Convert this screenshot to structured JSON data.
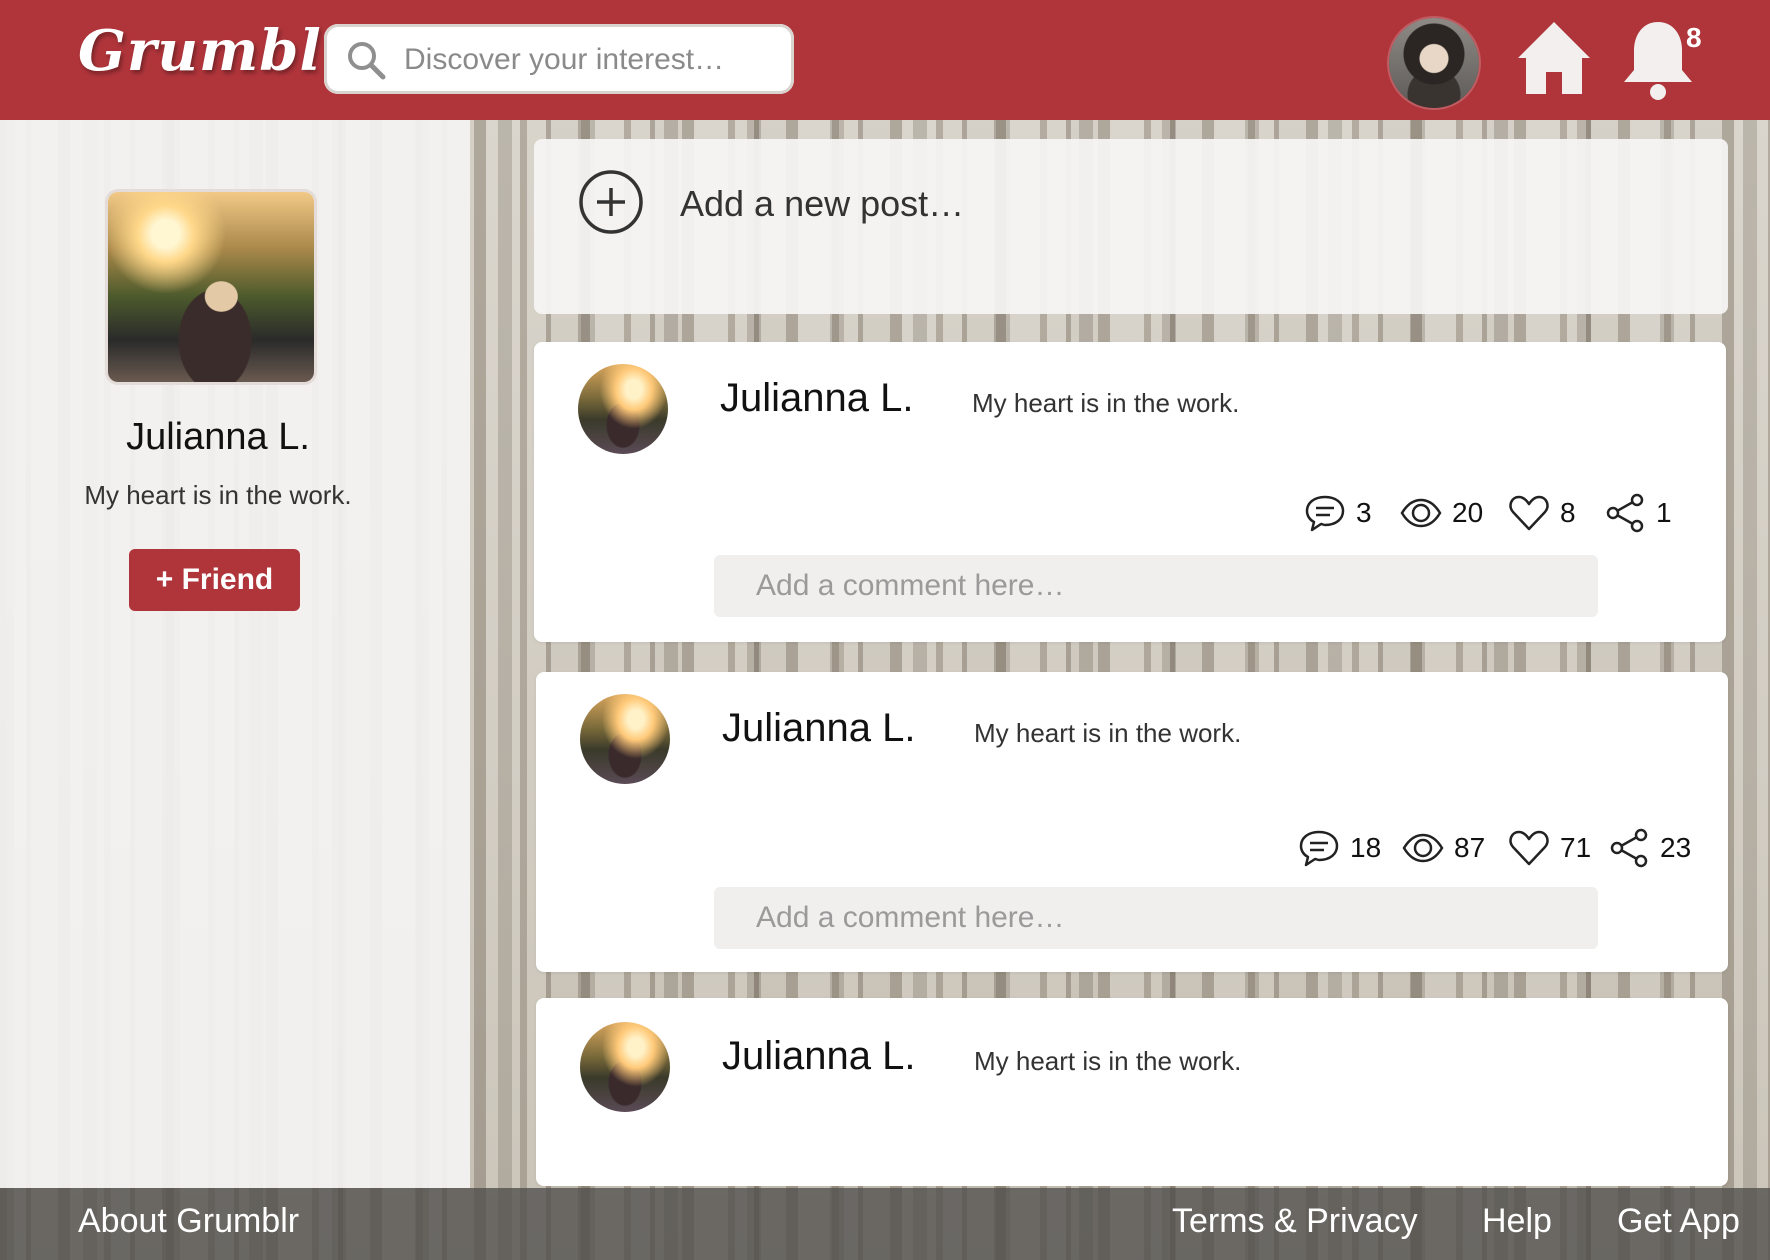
{
  "app": {
    "logo": "Grumblr"
  },
  "header": {
    "search_placeholder": "Discover your interest…",
    "notification_count": "8"
  },
  "profile": {
    "name": "Julianna L.",
    "tagline": "My heart is in the work.",
    "friend_button": "+ Friend"
  },
  "new_post": {
    "label": "Add a new post…"
  },
  "posts": [
    {
      "author": "Julianna L.",
      "text": "My heart is in the work.",
      "comments": "3",
      "views": "20",
      "likes": "8",
      "shares": "1",
      "comment_placeholder": "Add a comment here…"
    },
    {
      "author": "Julianna L.",
      "text": "My heart is in the work.",
      "comments": "18",
      "views": "87",
      "likes": "71",
      "shares": "23",
      "comment_placeholder": "Add a comment here…"
    },
    {
      "author": "Julianna L.",
      "text": "My heart is in the work."
    }
  ],
  "footer": {
    "about": "About Grumblr",
    "terms": "Terms & Privacy",
    "help": "Help",
    "get_app": "Get App"
  },
  "colors": {
    "brand": "#b0353b",
    "footer": "#504e4c",
    "card": "#ffffff"
  },
  "icons": [
    "search-icon",
    "home-icon",
    "bell-icon",
    "plus-circle-icon",
    "comment-icon",
    "eye-icon",
    "heart-icon",
    "share-icon"
  ]
}
